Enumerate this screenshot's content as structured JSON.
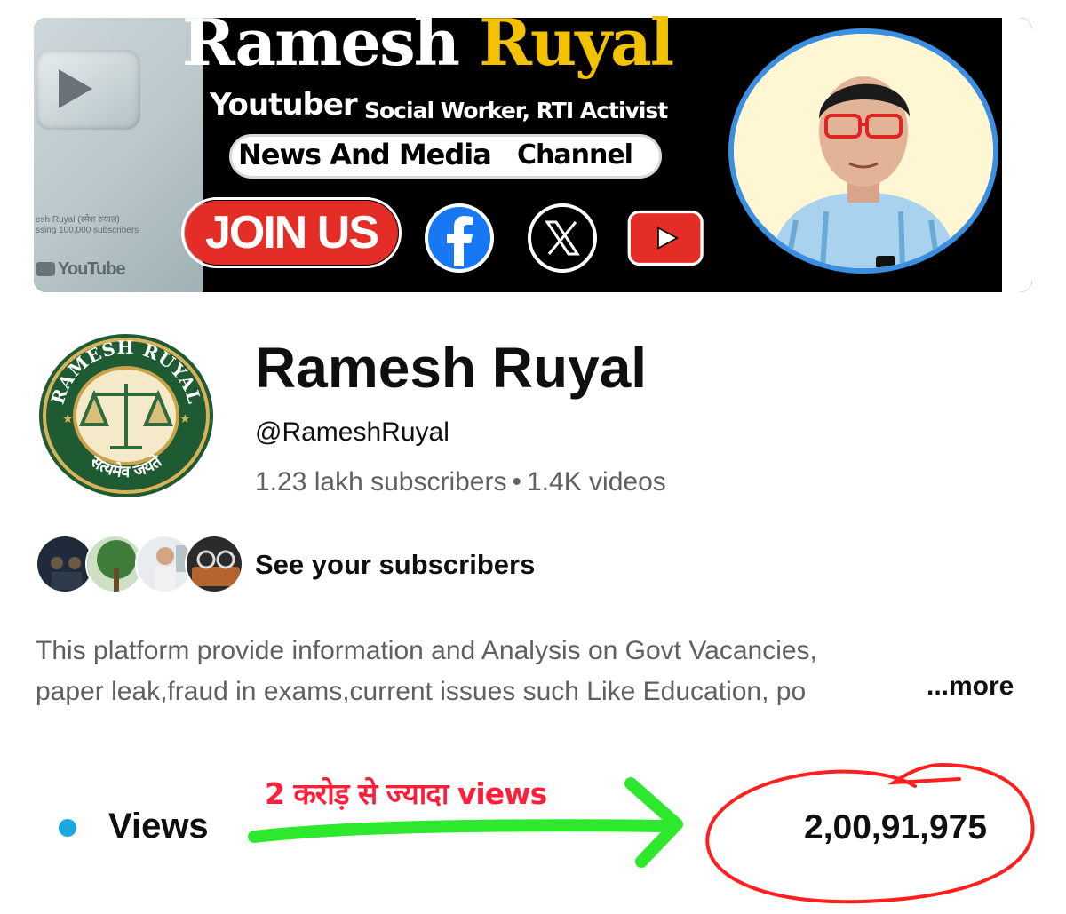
{
  "banner": {
    "first_name": "Ramesh",
    "last_name": "Ruyal",
    "role_primary": "Youtuber",
    "role_secondary": "Social Worker, RTI Activist",
    "pill_left": "News And Media",
    "pill_right": "Channel",
    "join_label": "JOIN US",
    "plaque_line1": "esh Ruyal (रमेश रुयाल)",
    "plaque_line2": "ssing 100,000 subscribers",
    "plaque_brand": "YouTube",
    "icons": [
      "facebook-icon",
      "x-icon",
      "youtube-icon"
    ]
  },
  "channel": {
    "title": "Ramesh Ruyal",
    "handle": "@RameshRuyal",
    "subscribers": "1.23 lakh subscribers",
    "separator": "•",
    "videos": "1.4K videos",
    "logo_text_top": "RAMESH RUYAL",
    "logo_text_bottom": "सत्यमेव जयते"
  },
  "subscribers_link": {
    "label": "See your subscribers"
  },
  "description": {
    "line1": "This platform provide  information and Analysis on Govt Vacancies,",
    "line2": "paper leak,fraud in exams,current issues such Like Education, po",
    "more_label": "...more"
  },
  "stats": {
    "views_label": "Views",
    "views_value": "2,00,91,975",
    "annotation": "2 करोड़ से ज्यादा views"
  },
  "colors": {
    "accent_blue": "#1aa6de",
    "annotation_red": "#ff1f3a",
    "arrow_green": "#2ee82e",
    "banner_gold": "#f2c200",
    "youtube_red": "#e52d27"
  }
}
